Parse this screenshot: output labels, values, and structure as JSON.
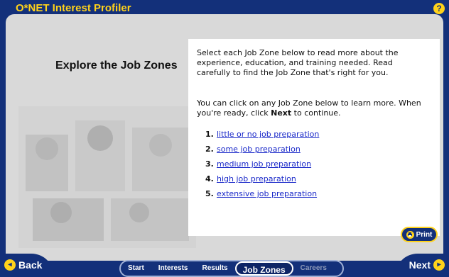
{
  "app": {
    "title": "O*NET Interest Profiler",
    "help_label": "?"
  },
  "page": {
    "heading": "Explore the Job Zones",
    "intro": "Select each Job Zone below to read more about the experience, education, and training needed. Read carefully to find the Job Zone that's right for you.",
    "instructions_before": "You can click on any Job Zone below to learn more. When you're ready, click ",
    "instructions_bold": "Next",
    "instructions_after": " to continue.",
    "zones": [
      {
        "num": "1.",
        "label": "little or no job preparation"
      },
      {
        "num": "2.",
        "label": "some job preparation"
      },
      {
        "num": "3.",
        "label": "medium job preparation"
      },
      {
        "num": "4.",
        "label": "high job preparation"
      },
      {
        "num": "5.",
        "label": "extensive job preparation"
      }
    ],
    "print_label": "Print"
  },
  "nav": {
    "back_label": "Back",
    "next_label": "Next",
    "tabs": [
      "Start",
      "Interests",
      "Results",
      "Job Zones",
      "Careers"
    ]
  },
  "colors": {
    "navy": "#13307a",
    "gold": "#ffd21a",
    "link": "#1a29c9"
  }
}
